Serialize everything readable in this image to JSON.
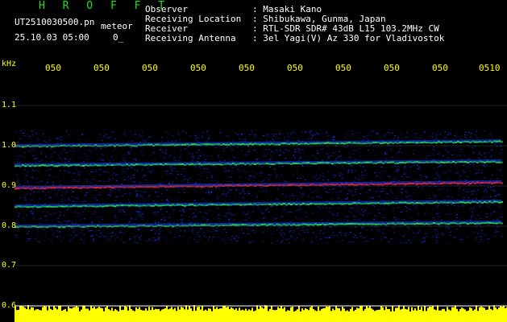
{
  "header": {
    "app_title": "H R O F F T",
    "filename": "UT2510030500.pn",
    "mode_label": "meteor",
    "datetime": "25.10.03 05:00",
    "count": "0_",
    "fields": [
      {
        "label": "Observer",
        "value": ": Masaki Kano"
      },
      {
        "label": "Receiving Location",
        "value": ": Shibukawa, Gunma, Japan"
      },
      {
        "label": "Receiver",
        "value": ": RTL-SDR SDR# 43dB L15 103.2MHz CW"
      },
      {
        "label": "Receiving Antenna",
        "value": ": 3el Yagi(V) Az 330 for Vladivostok"
      }
    ]
  },
  "y_axis": {
    "unit": "kHz",
    "ticks": [
      "1.1",
      "1.0",
      "0.9",
      "0.8",
      "0.7",
      "0.6"
    ]
  },
  "x_axis": {
    "ticks": [
      "050",
      "050",
      "050",
      "050",
      "050",
      "050",
      "050",
      "050",
      "050",
      "0510"
    ]
  },
  "colors": {
    "text_yellow": "#ffff00",
    "text_white": "#ffffff",
    "title_green": "#22dd22",
    "background": "#000000",
    "noise_blue": "#1a3cff",
    "band_green": "#22dd44",
    "signal_red": "#ff2222"
  }
}
